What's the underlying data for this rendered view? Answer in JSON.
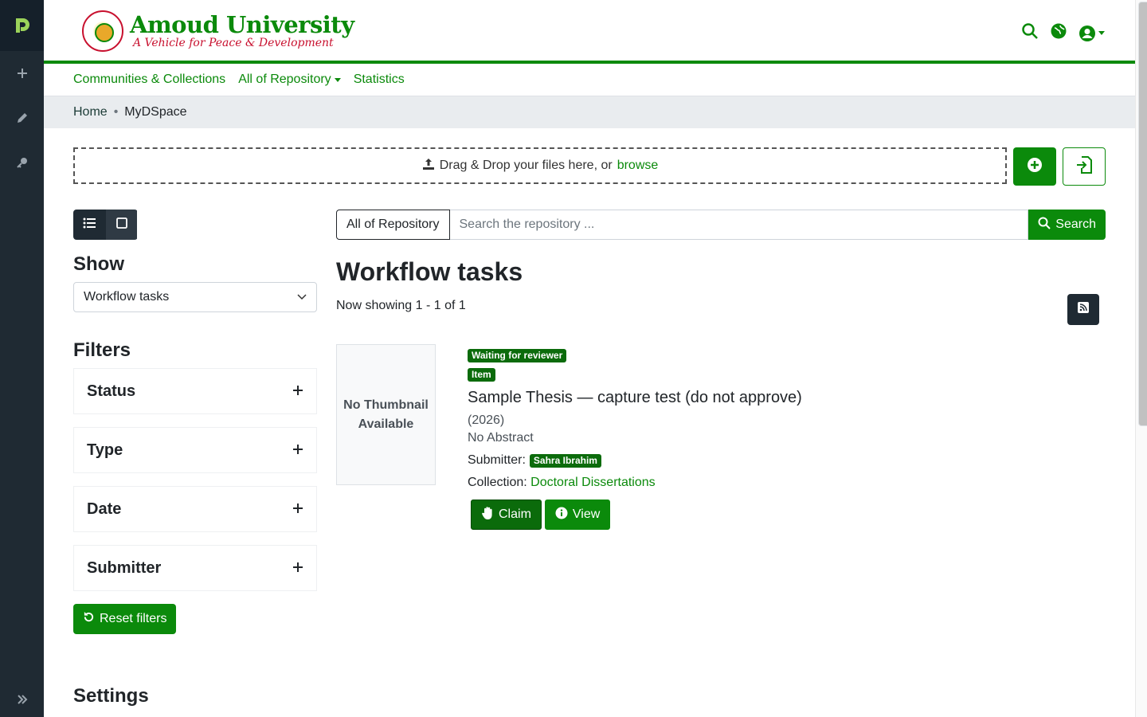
{
  "brand": {
    "name": "Amoud University",
    "motto": "A Vehicle for Peace & Development"
  },
  "nav": {
    "communities": "Communities & Collections",
    "all_repository": "All of Repository",
    "statistics": "Statistics"
  },
  "breadcrumb": {
    "home": "Home",
    "separator": "•",
    "current": "MyDSpace"
  },
  "upload": {
    "text": "Drag & Drop your files here, or",
    "browse": "browse"
  },
  "sidebar_filters": {
    "show_title": "Show",
    "show_value": "Workflow tasks",
    "filters_title": "Filters",
    "filters": [
      "Status",
      "Type",
      "Date",
      "Submitter"
    ],
    "reset": "Reset filters",
    "settings_title": "Settings"
  },
  "search": {
    "scope": "All of Repository",
    "placeholder": "Search the repository ...",
    "button": "Search"
  },
  "results": {
    "title": "Workflow tasks",
    "showing": "Now showing 1 - 1 of 1"
  },
  "item": {
    "thumbnail": "No Thumbnail Available",
    "status_badge": "Waiting for reviewer",
    "type_badge": "Item",
    "title": "Sample Thesis — capture test (do not approve)",
    "year": "(2026)",
    "abstract": "No Abstract",
    "submitter_label": "Submitter:",
    "submitter": "Sahra Ibrahim",
    "collection_label": "Collection:",
    "collection": "Doctoral Dissertations",
    "claim": "Claim",
    "view": "View"
  },
  "colors": {
    "accent": "#0b8a0b",
    "sidebar": "#1f2a33",
    "motto": "#c8102e"
  },
  "icons": [
    "dspace-logo-icon",
    "plus-icon",
    "pencil-icon",
    "key-icon",
    "search-icon",
    "globe-icon",
    "user-circle-icon",
    "upload-icon",
    "plus-circle-icon",
    "file-import-icon",
    "list-icon",
    "grid-icon",
    "chevron-down-icon",
    "undo-icon",
    "rss-icon",
    "hand-icon",
    "info-icon",
    "double-chevron-right-icon"
  ]
}
